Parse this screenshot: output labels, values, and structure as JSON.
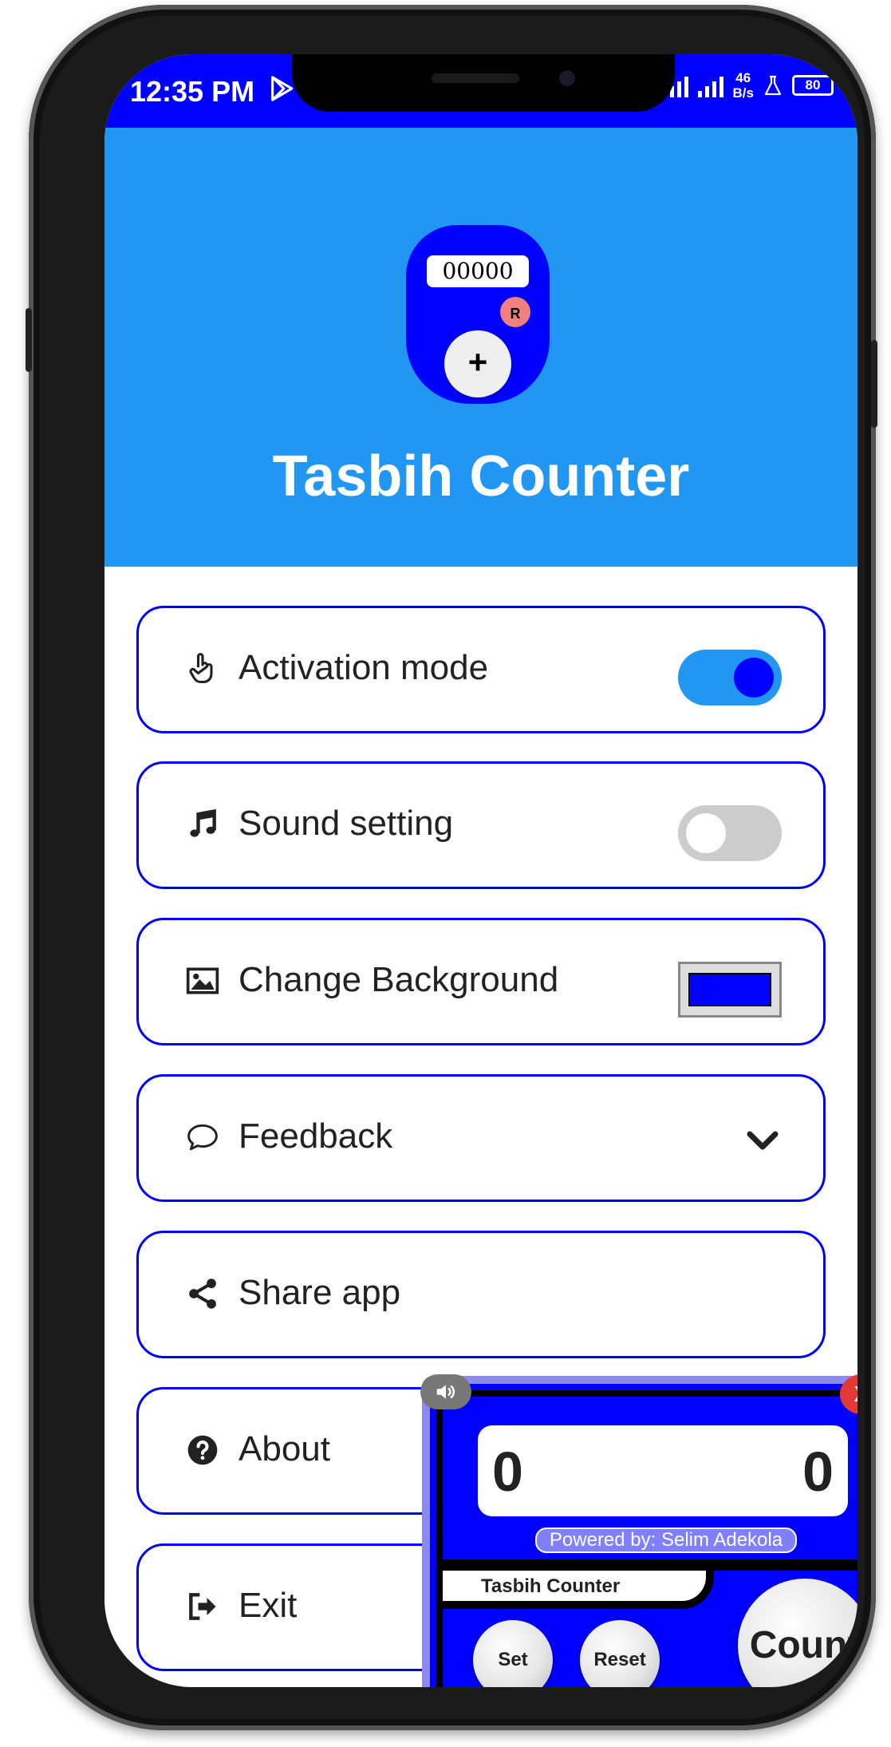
{
  "status_bar": {
    "time": "12:35 PM",
    "net_speed_value": "46",
    "net_speed_unit": "B/s",
    "battery": "80"
  },
  "header": {
    "logo_display": "00000",
    "logo_reset_label": "R",
    "logo_plus_label": "+",
    "title": "Tasbih Counter"
  },
  "menu": {
    "activation_mode": {
      "label": "Activation mode",
      "icon": "hand-pointer-icon",
      "enabled": true
    },
    "sound_setting": {
      "label": "Sound setting",
      "icon": "music-note-icon",
      "enabled": false
    },
    "change_background": {
      "label": "Change Background",
      "icon": "image-icon",
      "color": "#0000ff"
    },
    "feedback": {
      "label": "Feedback",
      "icon": "speech-bubble-icon"
    },
    "share_app": {
      "label": "Share app",
      "icon": "share-icon"
    },
    "about": {
      "label": "About",
      "icon": "question-circle-icon"
    },
    "exit": {
      "label": "Exit",
      "icon": "sign-out-icon"
    }
  },
  "widget": {
    "count_left": "0",
    "count_right": "0",
    "powered_by": "Powered by: Selim Adekola",
    "tab_title": "Tasbih Counter",
    "set_label": "Set",
    "reset_label": "Reset",
    "count_label": "Count",
    "close_label": "X"
  },
  "colors": {
    "status_bar": "#0000ff",
    "header": "#2196f3",
    "accent": "#0000ff",
    "close": "#e53935",
    "confirm": "#2e9e3e"
  }
}
